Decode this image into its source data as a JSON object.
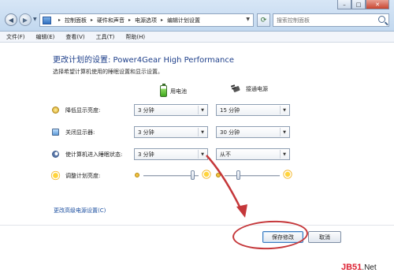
{
  "breadcrumb": [
    "控制面板",
    "硬件和声音",
    "电源选项",
    "编辑计划设置"
  ],
  "search": {
    "placeholder": "搜索控制面板"
  },
  "menu": [
    "文件(F)",
    "编辑(E)",
    "查看(V)",
    "工具(T)",
    "帮助(H)"
  ],
  "page": {
    "title": "更改计划的设置: Power4Gear High Performance",
    "subtitle": "选择希望计算机使用的睡眠设置和显示设置。"
  },
  "columns": {
    "battery": "用电池",
    "plugged": "接通电源"
  },
  "settings": [
    {
      "label": "降低显示亮度:",
      "battery": "3 分钟",
      "plugged": "15 分钟"
    },
    {
      "label": "关闭显示器:",
      "battery": "3 分钟",
      "plugged": "30 分钟"
    },
    {
      "label": "使计算机进入睡眠状态:",
      "battery": "3 分钟",
      "plugged": "从不"
    }
  ],
  "brightness": {
    "label": "调整计划亮度:",
    "battery_level": 0.9,
    "plugged_level": 0.25
  },
  "advanced_link": "更改高级电源设置(C)",
  "buttons": {
    "save": "保存修改",
    "cancel": "取消"
  },
  "watermark": {
    "part1": "JB51",
    "part2": ".Net"
  },
  "colors": {
    "title": "#1e3f8a",
    "link": "#1c4fa0",
    "annotation": "#c5373a"
  }
}
